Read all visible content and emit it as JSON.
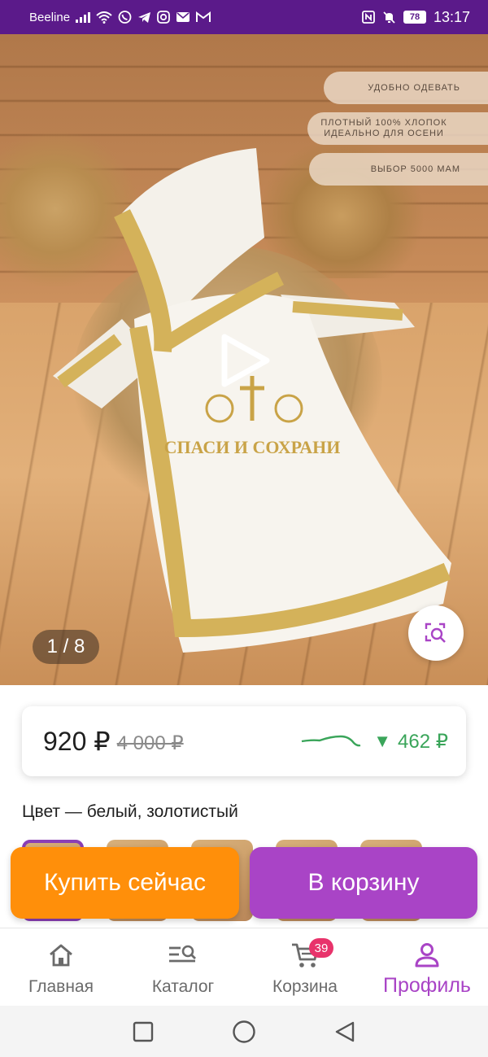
{
  "status_bar": {
    "carrier": "Beeline",
    "battery": "78",
    "time": "13:17",
    "icons": [
      "signal-icon",
      "wifi-icon",
      "viber-icon",
      "telegram-icon",
      "instagram-icon",
      "mail-icon",
      "gmail-icon",
      "nfc-icon",
      "mute-icon"
    ]
  },
  "gallery": {
    "counter": "1 / 8",
    "badges": [
      "УДОБНО ОДЕВАТЬ",
      "ПЛОТНЫЙ 100% ХЛОПОК ИДЕАЛЬНО ДЛЯ ОСЕНИ",
      "ВЫБОР 5000 МАМ"
    ],
    "embroidery_text": "СПАСИ И СОХРАНИ"
  },
  "price": {
    "current": "920 ₽",
    "old": "4 000 ₽",
    "trend": "462 ₽",
    "trend_color": "#3aa55a"
  },
  "product": {
    "color_label": "Цвет — белый, золотистый"
  },
  "actions": {
    "buy_now": "Купить сейчас",
    "add_to_cart": "В корзину",
    "buy_color": "#ff8f0a",
    "cart_color": "#a944c6"
  },
  "nav": {
    "items": [
      {
        "label": "Главная",
        "icon": "home-icon"
      },
      {
        "label": "Каталог",
        "icon": "catalog-search-icon"
      },
      {
        "label": "Корзина",
        "icon": "cart-icon",
        "badge": "39"
      },
      {
        "label": "Профиль",
        "icon": "profile-icon",
        "active": true
      }
    ]
  },
  "theme": {
    "accent": "#a944c6",
    "status_bar": "#5b1a8a"
  }
}
